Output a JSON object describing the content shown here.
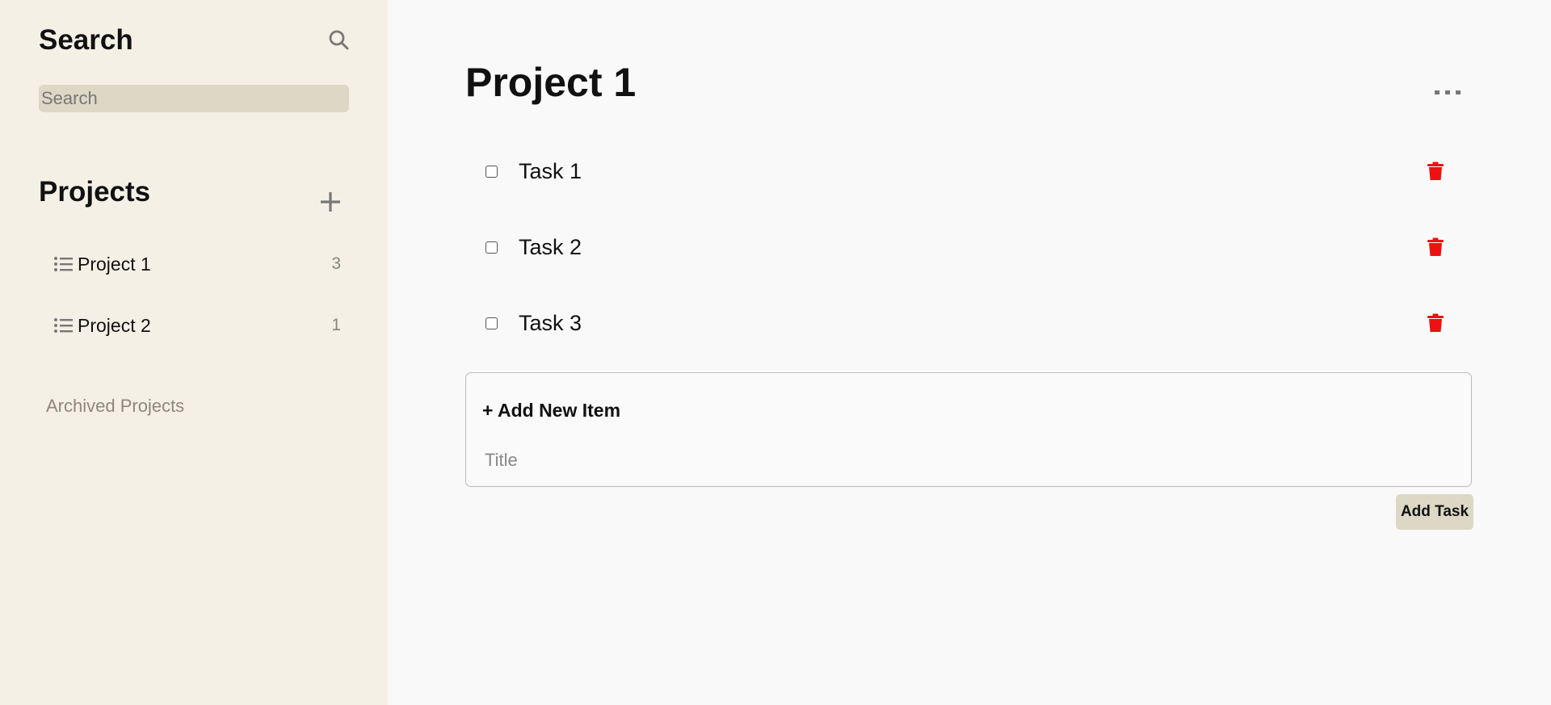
{
  "sidebar": {
    "search_title": "Search",
    "search_icon": "search-icon",
    "search_placeholder": "Search",
    "projects_title": "Projects",
    "add_project_icon": "plus-icon",
    "projects": [
      {
        "name": "Project 1",
        "count": "3",
        "icon": "list-icon"
      },
      {
        "name": "Project 2",
        "count": "1",
        "icon": "list-icon"
      }
    ],
    "archived_label": "Archived Projects"
  },
  "main": {
    "title": "Project 1",
    "more_icon": "more-horizontal-icon",
    "tasks": [
      {
        "title": "Task 1",
        "checked": false,
        "delete_icon": "trash-icon"
      },
      {
        "title": "Task 2",
        "checked": false,
        "delete_icon": "trash-icon"
      },
      {
        "title": "Task 3",
        "checked": false,
        "delete_icon": "trash-icon"
      }
    ],
    "add_item": {
      "heading": "+ Add New Item",
      "title_placeholder": "Title",
      "title_value": ""
    },
    "add_task_button": "Add Task"
  },
  "colors": {
    "sidebar_bg": "#f5f0e6",
    "main_bg": "#f9f9f9",
    "input_bg": "#ddd7c6",
    "delete_red": "#ee1111",
    "muted_text": "#8d877d"
  }
}
